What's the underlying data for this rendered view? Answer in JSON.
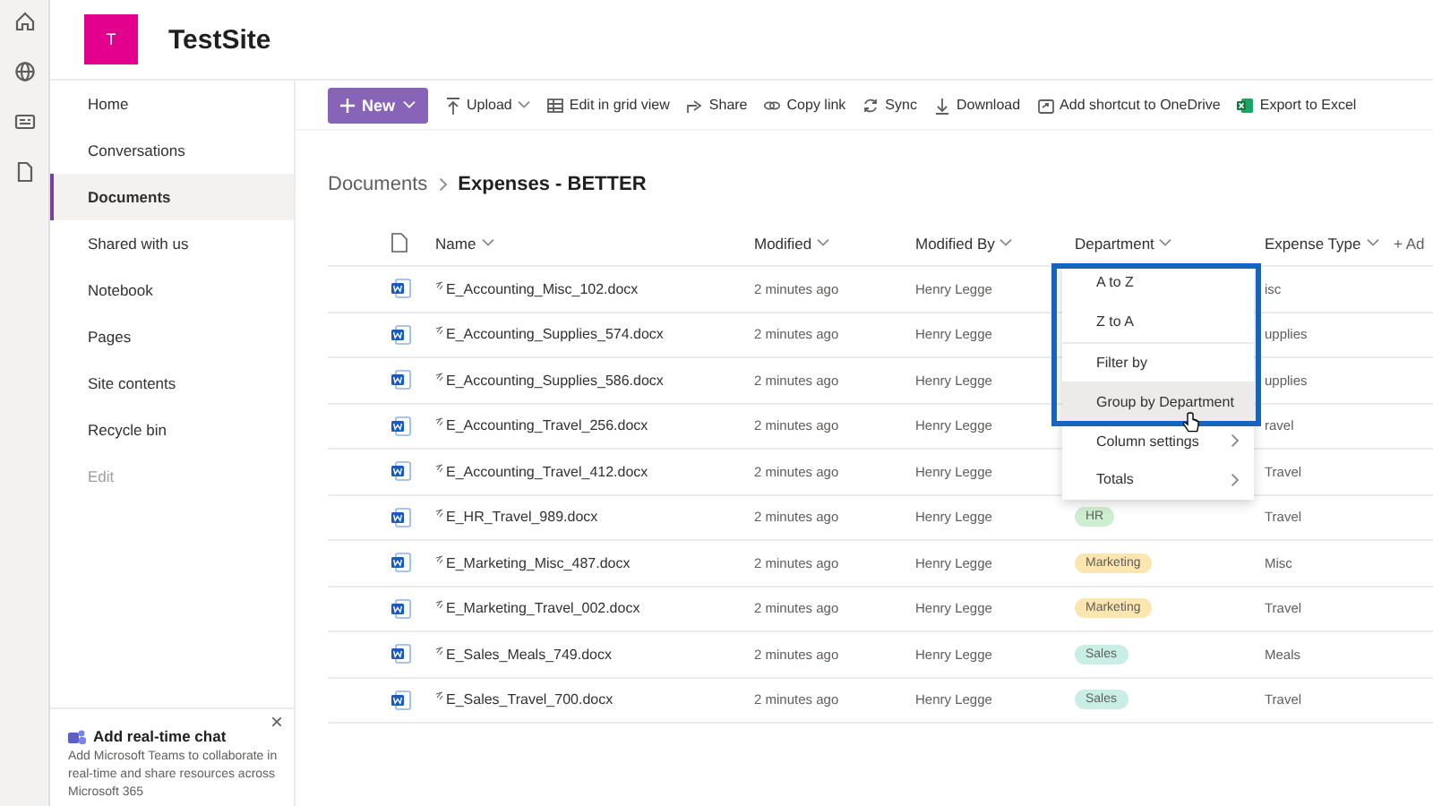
{
  "site": {
    "logo_letter": "T",
    "title": "TestSite"
  },
  "nav": {
    "items": [
      {
        "label": "Home",
        "selected": false,
        "disabled": false
      },
      {
        "label": "Conversations",
        "selected": false,
        "disabled": false
      },
      {
        "label": "Documents",
        "selected": true,
        "disabled": false
      },
      {
        "label": "Shared with us",
        "selected": false,
        "disabled": false
      },
      {
        "label": "Notebook",
        "selected": false,
        "disabled": false
      },
      {
        "label": "Pages",
        "selected": false,
        "disabled": false
      },
      {
        "label": "Site contents",
        "selected": false,
        "disabled": false
      },
      {
        "label": "Recycle bin",
        "selected": false,
        "disabled": false
      },
      {
        "label": "Edit",
        "selected": false,
        "disabled": true
      }
    ]
  },
  "chat_card": {
    "title": "Add real-time chat",
    "body": "Add Microsoft Teams to collaborate in real-time and share resources across Microsoft 365",
    "close": "×"
  },
  "command_bar": {
    "new_button": "New",
    "commands": [
      {
        "label": "Upload",
        "kind": "upload",
        "dropdown": true
      },
      {
        "label": "Edit in grid view",
        "kind": "grid",
        "dropdown": false
      },
      {
        "label": "Share",
        "kind": "share",
        "dropdown": false
      },
      {
        "label": "Copy link",
        "kind": "link",
        "dropdown": false
      },
      {
        "label": "Sync",
        "kind": "sync",
        "dropdown": false
      },
      {
        "label": "Download",
        "kind": "download",
        "dropdown": false
      },
      {
        "label": "Add shortcut to OneDrive",
        "kind": "shortcut",
        "dropdown": false
      },
      {
        "label": "Export to Excel",
        "kind": "excel",
        "dropdown": false
      }
    ]
  },
  "breadcrumb": {
    "parent": "Documents",
    "current": "Expenses - BETTER"
  },
  "table": {
    "columns": [
      "Name",
      "Modified",
      "Modified By",
      "Department",
      "Expense Type"
    ],
    "add_column": "+ Ad",
    "rows": [
      {
        "name": "E_Accounting_Misc_102.docx",
        "modified": "2 minutes ago",
        "modified_by": "Henry Legge",
        "expense_type": "isc"
      },
      {
        "name": "E_Accounting_Supplies_574.docx",
        "modified": "2 minutes ago",
        "modified_by": "Henry Legge",
        "expense_type": "upplies"
      },
      {
        "name": "E_Accounting_Supplies_586.docx",
        "modified": "2 minutes ago",
        "modified_by": "Henry Legge",
        "expense_type": "upplies"
      },
      {
        "name": "E_Accounting_Travel_256.docx",
        "modified": "2 minutes ago",
        "modified_by": "Henry Legge",
        "expense_type": "ravel"
      },
      {
        "name": "E_Accounting_Travel_412.docx",
        "modified": "2 minutes ago",
        "modified_by": "Henry Legge",
        "expense_type": "Travel"
      },
      {
        "name": "E_HR_Travel_989.docx",
        "modified": "2 minutes ago",
        "modified_by": "Henry Legge",
        "department": {
          "label": "HR",
          "color": "#cdeecf"
        },
        "expense_type": "Travel"
      },
      {
        "name": "E_Marketing_Misc_487.docx",
        "modified": "2 minutes ago",
        "modified_by": "Henry Legge",
        "department": {
          "label": "Marketing",
          "color": "#fbe6b0"
        },
        "expense_type": "Misc"
      },
      {
        "name": "E_Marketing_Travel_002.docx",
        "modified": "2 minutes ago",
        "modified_by": "Henry Legge",
        "department": {
          "label": "Marketing",
          "color": "#fbe6b0"
        },
        "expense_type": "Travel"
      },
      {
        "name": "E_Sales_Meals_749.docx",
        "modified": "2 minutes ago",
        "modified_by": "Henry Legge",
        "department": {
          "label": "Sales",
          "color": "#c8eee6"
        },
        "expense_type": "Meals"
      },
      {
        "name": "E_Sales_Travel_700.docx",
        "modified": "2 minutes ago",
        "modified_by": "Henry Legge",
        "department": {
          "label": "Sales",
          "color": "#c8eee6"
        },
        "expense_type": "Travel"
      }
    ]
  },
  "column_menu": {
    "items": [
      {
        "label": "A to Z",
        "hovered": false,
        "submenu": false,
        "divider_after": false
      },
      {
        "label": "Z to A",
        "hovered": false,
        "submenu": false,
        "divider_after": true
      },
      {
        "label": "Filter by",
        "hovered": false,
        "submenu": false,
        "divider_after": false
      },
      {
        "label": "Group by Department",
        "hovered": true,
        "submenu": false,
        "divider_after": false
      },
      {
        "label": "Column settings",
        "hovered": false,
        "submenu": true,
        "divider_after": false
      },
      {
        "label": "Totals",
        "hovered": false,
        "submenu": true,
        "divider_after": false
      }
    ]
  }
}
